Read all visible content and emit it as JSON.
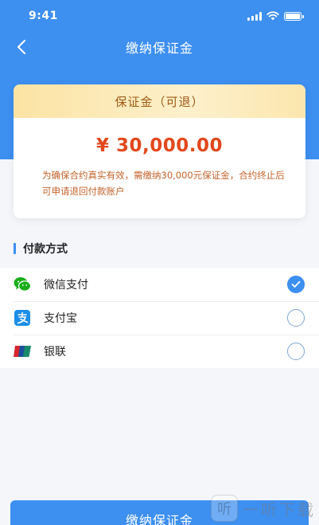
{
  "status_bar": {
    "time": "9:41",
    "icons": [
      "signal-icon",
      "wifi-icon",
      "battery-icon"
    ]
  },
  "nav": {
    "title": "缴纳保证金",
    "back_icon": "chevron-left-icon"
  },
  "deposit": {
    "header": "保证金（可退）",
    "amount": "¥ 30,000.00",
    "note": "为确保合约真实有效，需缴纳30,000元保证金，合约终止后可申请退回付款账户"
  },
  "payment": {
    "section_title": "付款方式",
    "methods": [
      {
        "label": "微信支付",
        "icon": "wechat-pay-icon",
        "selected": true
      },
      {
        "label": "支付宝",
        "icon": "alipay-icon",
        "selected": false
      },
      {
        "label": "银联",
        "icon": "unionpay-icon",
        "selected": false
      }
    ]
  },
  "submit": {
    "label": "缴纳保证金"
  },
  "watermark": {
    "logo": "听",
    "text": "一听下载"
  },
  "colors": {
    "primary": "#3d8ff0",
    "amount": "#e2481c",
    "note": "#c2622a",
    "card_header_text": "#9b5b15",
    "wechat": "#1aad19",
    "alipay": "#1c8ee8"
  }
}
